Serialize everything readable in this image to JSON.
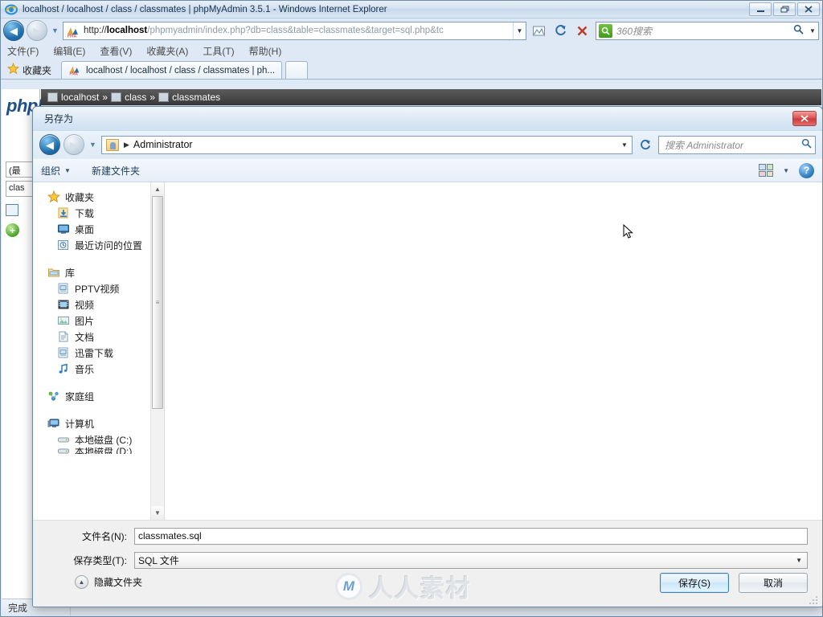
{
  "browser": {
    "title": "localhost / localhost / class / classmates | phpMyAdmin 3.5.1 - Windows Internet Explorer",
    "window_buttons": {
      "minimize": "–",
      "restore": "❐",
      "close": "✕"
    },
    "address": {
      "scheme": "http://",
      "host": "localhost",
      "path": "/phpmyadmin/index.php?db=class&table=classmates&target=sql.php&tc",
      "full": "http://localhost/phpmyadmin/index.php?db=class&table=classmates&target=sql.php&tc"
    },
    "search": {
      "placeholder": "360搜索",
      "engine": "360搜索"
    },
    "menu": [
      "文件(F)",
      "编辑(E)",
      "查看(V)",
      "收藏夹(A)",
      "工具(T)",
      "帮助(H)"
    ],
    "favorites_label": "收藏夹",
    "tab_label": "localhost / localhost / class / classmates | ph...",
    "status": "完成"
  },
  "page": {
    "logo": "phpMyAdmin",
    "sidebar_select_1": "(最",
    "sidebar_select_2": "clas",
    "breadcrumb": [
      "localhost",
      "class",
      "classmates"
    ],
    "breadcrumb_sep": "»"
  },
  "dialog": {
    "title": "另存为",
    "close_label": "✕",
    "address_crumb": "Administrator",
    "search_placeholder": "搜索 Administrator",
    "toolbar": {
      "organize": "组织",
      "new_folder": "新建文件夹",
      "help": "?"
    },
    "nav_pane": [
      {
        "label": "收藏夹",
        "icon": "star-icon",
        "level": "group"
      },
      {
        "label": "下载",
        "icon": "download-icon",
        "level": "child"
      },
      {
        "label": "桌面",
        "icon": "desktop-icon",
        "level": "child"
      },
      {
        "label": "最近访问的位置",
        "icon": "recent-places-icon",
        "level": "child"
      },
      {
        "label": "库",
        "icon": "library-icon",
        "level": "group",
        "spacer_before": true
      },
      {
        "label": "PPTV视频",
        "icon": "video-library-icon",
        "level": "child"
      },
      {
        "label": "视频",
        "icon": "video-icon",
        "level": "child"
      },
      {
        "label": "图片",
        "icon": "pictures-icon",
        "level": "child"
      },
      {
        "label": "文档",
        "icon": "documents-icon",
        "level": "child"
      },
      {
        "label": "迅雷下载",
        "icon": "thunder-download-icon",
        "level": "child"
      },
      {
        "label": "音乐",
        "icon": "music-icon",
        "level": "child"
      },
      {
        "label": "家庭组",
        "icon": "homegroup-icon",
        "level": "group",
        "spacer_before": true
      },
      {
        "label": "计算机",
        "icon": "computer-icon",
        "level": "group",
        "spacer_before": true
      },
      {
        "label": "本地磁盘 (C:)",
        "icon": "drive-icon",
        "level": "child"
      },
      {
        "label": "本地磁盘 (D:)",
        "icon": "drive-icon",
        "level": "child"
      }
    ],
    "filename_label": "文件名(N):",
    "filename_value": "classmates.sql",
    "filetype_label": "保存类型(T):",
    "filetype_value": "SQL 文件",
    "hide_folders": "隐藏文件夹",
    "save_button": "保存(S)",
    "cancel_button": "取消"
  },
  "watermark": {
    "mark": "M",
    "text": "人人素材"
  }
}
